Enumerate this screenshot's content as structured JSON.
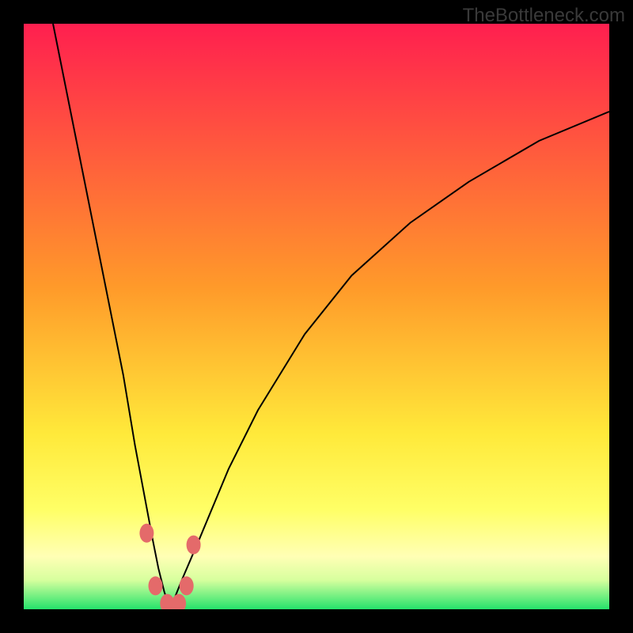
{
  "watermark": "TheBottleneck.com",
  "chart_data": {
    "type": "line",
    "title": "",
    "xlabel": "",
    "ylabel": "",
    "xlim": [
      0,
      100
    ],
    "ylim": [
      0,
      100
    ],
    "optimal_x": 25,
    "gradient_stops": [
      {
        "pct": 0,
        "color": "#ff1f4f"
      },
      {
        "pct": 45,
        "color": "#ff9a2a"
      },
      {
        "pct": 70,
        "color": "#ffe93a"
      },
      {
        "pct": 83,
        "color": "#ffff66"
      },
      {
        "pct": 91,
        "color": "#ffffb5"
      },
      {
        "pct": 95,
        "color": "#d7ff9e"
      },
      {
        "pct": 100,
        "color": "#25e36b"
      }
    ],
    "series": [
      {
        "name": "left",
        "x": [
          5,
          8,
          11,
          14,
          17,
          19,
          20.5,
          22,
          23,
          24,
          25
        ],
        "y": [
          100,
          85,
          70,
          55,
          40,
          28,
          20,
          12,
          7,
          3,
          0
        ]
      },
      {
        "name": "right",
        "x": [
          25,
          27,
          30,
          35,
          40,
          48,
          56,
          66,
          76,
          88,
          100
        ],
        "y": [
          0,
          5,
          12,
          24,
          34,
          47,
          57,
          66,
          73,
          80,
          85
        ]
      }
    ],
    "markers": [
      {
        "x": 21.0,
        "y": 13
      },
      {
        "x": 22.5,
        "y": 4
      },
      {
        "x": 24.5,
        "y": 1
      },
      {
        "x": 26.5,
        "y": 1
      },
      {
        "x": 27.8,
        "y": 4
      },
      {
        "x": 29.0,
        "y": 11
      }
    ],
    "marker_color": "#e46a6a"
  }
}
